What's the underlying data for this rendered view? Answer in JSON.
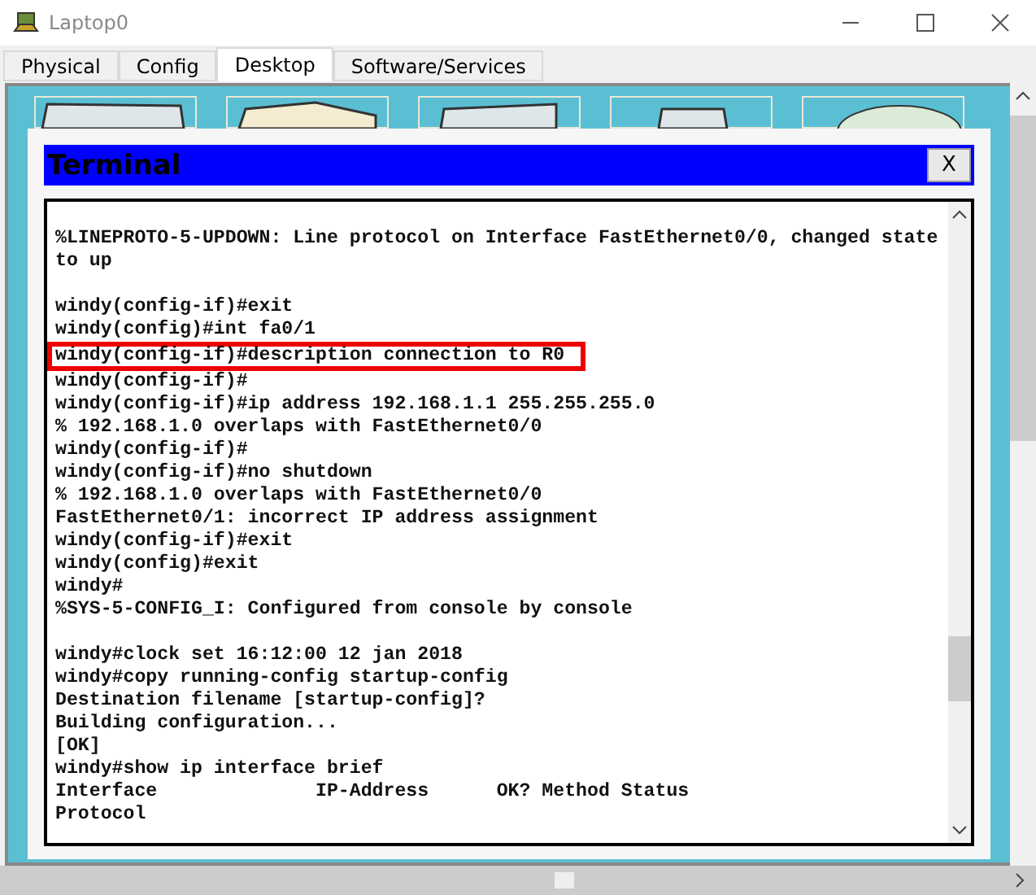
{
  "window": {
    "title": "Laptop0"
  },
  "tabs": [
    {
      "label": "Physical",
      "selected": false
    },
    {
      "label": "Config",
      "selected": false
    },
    {
      "label": "Desktop",
      "selected": true
    },
    {
      "label": "Software/Services",
      "selected": false
    }
  ],
  "terminal": {
    "title": "Terminal",
    "close_label": "X",
    "blocks": [
      [
        {
          "text": "%LINEPROTO-5-UPDOWN: Line protocol on Interface FastEthernet0/0, changed state to up",
          "highlighted": false
        }
      ],
      [
        {
          "text": "windy(config-if)#exit",
          "highlighted": false
        },
        {
          "text": "windy(config)#int fa0/1",
          "highlighted": false
        },
        {
          "text": "windy(config-if)#description connection to R0",
          "highlighted": true
        },
        {
          "text": "windy(config-if)#",
          "highlighted": false
        },
        {
          "text": "windy(config-if)#ip address 192.168.1.1 255.255.255.0",
          "highlighted": false
        },
        {
          "text": "% 192.168.1.0 overlaps with FastEthernet0/0",
          "highlighted": false
        },
        {
          "text": "windy(config-if)#",
          "highlighted": false
        },
        {
          "text": "windy(config-if)#no shutdown",
          "highlighted": false
        },
        {
          "text": "% 192.168.1.0 overlaps with FastEthernet0/0",
          "highlighted": false
        },
        {
          "text": "FastEthernet0/1: incorrect IP address assignment",
          "highlighted": false
        },
        {
          "text": "windy(config-if)#exit",
          "highlighted": false
        },
        {
          "text": "windy(config)#exit",
          "highlighted": false
        },
        {
          "text": "windy#",
          "highlighted": false
        },
        {
          "text": "%SYS-5-CONFIG_I: Configured from console by console",
          "highlighted": false
        }
      ],
      [
        {
          "text": "windy#clock set 16:12:00 12 jan 2018",
          "highlighted": false
        },
        {
          "text": "windy#copy running-config startup-config",
          "highlighted": false
        },
        {
          "text": "Destination filename [startup-config]?",
          "highlighted": false
        },
        {
          "text": "Building configuration...",
          "highlighted": false
        },
        {
          "text": "[OK]",
          "highlighted": false
        },
        {
          "text": "windy#show ip interface brief",
          "highlighted": false
        },
        {
          "text": "Interface              IP-Address      OK? Method Status",
          "highlighted": false
        },
        {
          "text": "Protocol",
          "highlighted": false
        }
      ]
    ]
  }
}
